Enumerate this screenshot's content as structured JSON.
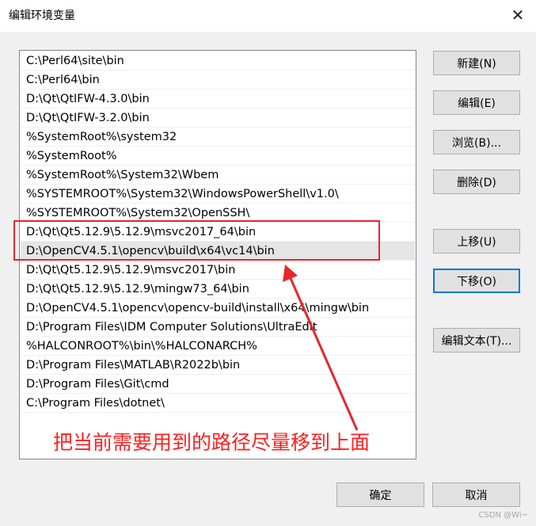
{
  "window": {
    "title": "编辑环境变量"
  },
  "path_list": [
    "C:\\Perl64\\site\\bin",
    "C:\\Perl64\\bin",
    "D:\\Qt\\QtIFW-4.3.0\\bin",
    "D:\\Qt\\QtIFW-3.2.0\\bin",
    "%SystemRoot%\\system32",
    "%SystemRoot%",
    "%SystemRoot%\\System32\\Wbem",
    "%SYSTEMROOT%\\System32\\WindowsPowerShell\\v1.0\\",
    "%SYSTEMROOT%\\System32\\OpenSSH\\",
    "D:\\Qt\\Qt5.12.9\\5.12.9\\msvc2017_64\\bin",
    "D:\\OpenCV4.5.1\\opencv\\build\\x64\\vc14\\bin",
    "D:\\Qt\\Qt5.12.9\\5.12.9\\msvc2017\\bin",
    "D:\\Qt\\Qt5.12.9\\5.12.9\\mingw73_64\\bin",
    "D:\\OpenCV4.5.1\\opencv\\opencv-build\\install\\x64\\mingw\\bin",
    "D:\\Program Files\\IDM Computer Solutions\\UltraEdit",
    "%HALCONROOT%\\bin\\%HALCONARCH%",
    "D:\\Program Files\\MATLAB\\R2022b\\bin",
    "D:\\Program Files\\Git\\cmd",
    "C:\\Program Files\\dotnet\\"
  ],
  "selected_index": 10,
  "buttons": {
    "new": "新建(N)",
    "edit": "编辑(E)",
    "browse": "浏览(B)...",
    "delete": "删除(D)",
    "move_up": "上移(U)",
    "move_down": "下移(O)",
    "edit_text": "编辑文本(T)...",
    "ok": "确定",
    "cancel": "取消"
  },
  "annotation": {
    "text": "把当前需要用到的路径尽量移到上面",
    "color": "#ff1f1f"
  },
  "watermark": "CSDN @Wi~",
  "colors": {
    "focus_border": "#0078d7",
    "selected_row": "#e5e5e5"
  }
}
